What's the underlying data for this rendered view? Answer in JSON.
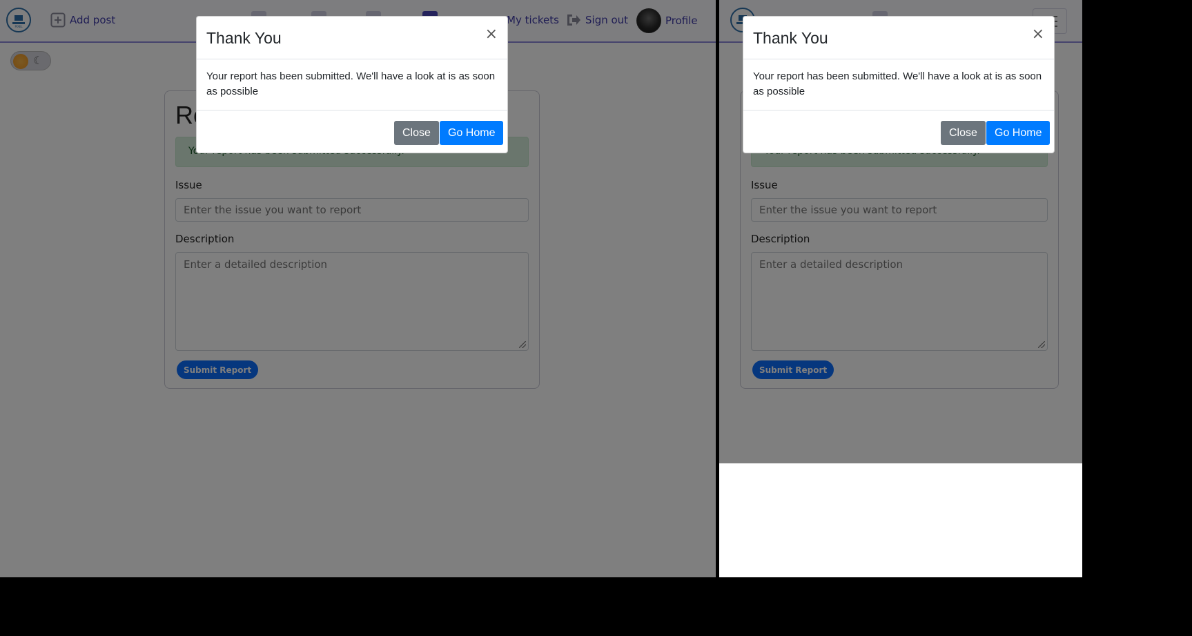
{
  "desktop": {
    "navbar": {
      "logo_icon": "site-logo",
      "add_post_label": "Add post",
      "my_tickets_label": "My tickets",
      "sign_out_label": "Sign out",
      "profile_label": "Profile",
      "accent_color": "#3f3aa8"
    },
    "form": {
      "heading": "Re",
      "success_text": "Your report has been submitted successfully.",
      "issue_label": "Issue",
      "issue_placeholder": "Enter the issue you want to report",
      "description_label": "Description",
      "description_placeholder": "Enter a detailed description",
      "submit_label": "Submit Report"
    },
    "modal": {
      "title": "Thank You",
      "close_symbol": "×",
      "message": "Your report has been submitted. We'll have a look at is as soon as possible",
      "close_label": "Close",
      "go_home_label": "Go Home"
    }
  },
  "mobile": {
    "form": {
      "success_text": "Your report has been submitted successfully.",
      "issue_label": "Issue",
      "issue_placeholder": "Enter the issue you want to report",
      "description_label": "Description",
      "description_placeholder": "Enter a detailed description",
      "submit_label": "Submit Report"
    },
    "modal": {
      "title": "Thank You",
      "close_symbol": "×",
      "message": "Your report has been submitted. We'll have a look at is as soon as possible",
      "close_label": "Close",
      "go_home_label": "Go Home"
    }
  },
  "colors": {
    "primary": "#007bff",
    "secondary": "#6c757d",
    "success_bg": "#d4edda"
  }
}
